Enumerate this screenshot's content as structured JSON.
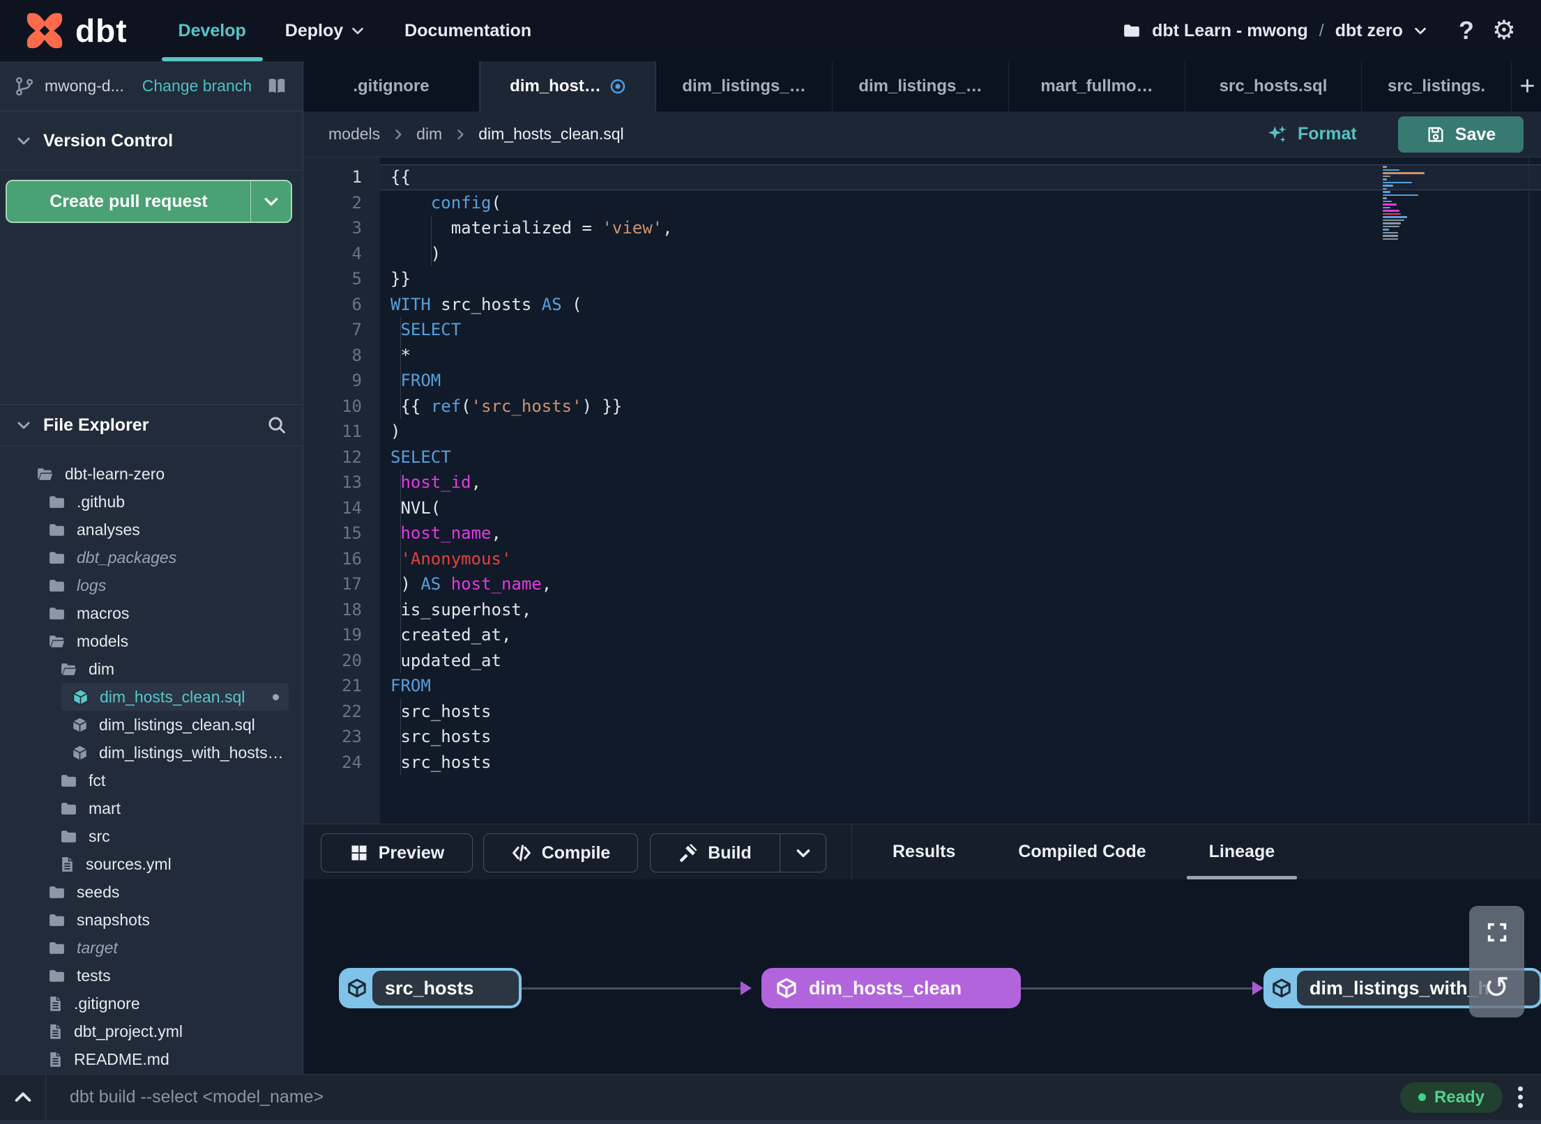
{
  "nav": {
    "brand": "dbt",
    "items": [
      {
        "label": "Develop",
        "active": true
      },
      {
        "label": "Deploy",
        "dropdown": true
      },
      {
        "label": "Documentation"
      }
    ],
    "project": {
      "name": "dbt Learn - mwong",
      "separator": "/",
      "env": "dbt zero"
    },
    "help": "?"
  },
  "icons": {
    "gear": "⚙",
    "refresh": "↺",
    "plus_label": "+"
  },
  "sidebar": {
    "branch": {
      "name": "mwong-d...",
      "action": "Change branch"
    },
    "version_control": {
      "title": "Version Control",
      "button": "Create pull request"
    },
    "file_explorer": {
      "title": "File Explorer",
      "tree": [
        {
          "label": "dbt-learn-zero",
          "depth": 0,
          "icon": "folder-open"
        },
        {
          "label": ".github",
          "depth": 1,
          "icon": "folder"
        },
        {
          "label": "analyses",
          "depth": 1,
          "icon": "folder"
        },
        {
          "label": "dbt_packages",
          "depth": 1,
          "icon": "folder",
          "italic": true
        },
        {
          "label": "logs",
          "depth": 1,
          "icon": "folder",
          "italic": true
        },
        {
          "label": "macros",
          "depth": 1,
          "icon": "folder"
        },
        {
          "label": "models",
          "depth": 1,
          "icon": "folder-open"
        },
        {
          "label": "dim",
          "depth": 2,
          "icon": "folder-open"
        },
        {
          "label": "dim_hosts_clean.sql",
          "depth": 3,
          "icon": "model",
          "selected": true,
          "modified": true
        },
        {
          "label": "dim_listings_clean.sql",
          "depth": 3,
          "icon": "model"
        },
        {
          "label": "dim_listings_with_hosts…",
          "depth": 3,
          "icon": "model"
        },
        {
          "label": "fct",
          "depth": 2,
          "icon": "folder"
        },
        {
          "label": "mart",
          "depth": 2,
          "icon": "folder"
        },
        {
          "label": "src",
          "depth": 2,
          "icon": "folder"
        },
        {
          "label": "sources.yml",
          "depth": 2,
          "icon": "file"
        },
        {
          "label": "seeds",
          "depth": 1,
          "icon": "folder"
        },
        {
          "label": "snapshots",
          "depth": 1,
          "icon": "folder"
        },
        {
          "label": "target",
          "depth": 1,
          "icon": "folder",
          "italic": true
        },
        {
          "label": "tests",
          "depth": 1,
          "icon": "folder"
        },
        {
          "label": ".gitignore",
          "depth": 1,
          "icon": "file"
        },
        {
          "label": "dbt_project.yml",
          "depth": 1,
          "icon": "file"
        },
        {
          "label": "README.md",
          "depth": 1,
          "icon": "file"
        }
      ]
    }
  },
  "tabs": {
    "items": [
      {
        "label": ".gitignore"
      },
      {
        "label": "dim_host…",
        "active": true,
        "modified": true
      },
      {
        "label": "dim_listings_…"
      },
      {
        "label": "dim_listings_…"
      },
      {
        "label": "mart_fullmo…"
      },
      {
        "label": "src_hosts.sql"
      },
      {
        "label": "src_listings.",
        "last": true
      }
    ],
    "add": "+"
  },
  "editor": {
    "breadcrumb": [
      "models",
      "dim",
      "dim_hosts_clean.sql"
    ],
    "format_label": "Format",
    "save_label": "Save",
    "lines": [
      {
        "current": true,
        "tokens": [
          [
            "w",
            "{{"
          ]
        ]
      },
      {
        "tokens": [
          [
            "w",
            "    "
          ],
          [
            "f",
            "config"
          ],
          [
            "w",
            "("
          ]
        ]
      },
      {
        "tokens": [
          [
            "w",
            "    "
          ],
          [
            "g",
            ""
          ],
          [
            "w",
            "  materialized = "
          ],
          [
            "s",
            "'view'"
          ],
          [
            "w",
            ","
          ]
        ]
      },
      {
        "tokens": [
          [
            "w",
            "    "
          ],
          [
            "g",
            ""
          ],
          [
            "w",
            ")"
          ]
        ]
      },
      {
        "tokens": [
          [
            "w",
            "}}"
          ]
        ]
      },
      {
        "tokens": [
          [
            "k",
            "WITH"
          ],
          [
            "w",
            " src_hosts "
          ],
          [
            "k",
            "AS"
          ],
          [
            "w",
            " ("
          ]
        ]
      },
      {
        "tokens": [
          [
            "w",
            " "
          ],
          [
            "g",
            ""
          ],
          [
            "k",
            "SELECT"
          ]
        ]
      },
      {
        "tokens": [
          [
            "w",
            " "
          ],
          [
            "g",
            ""
          ],
          [
            "w",
            "*"
          ]
        ]
      },
      {
        "tokens": [
          [
            "w",
            " "
          ],
          [
            "g",
            ""
          ],
          [
            "k",
            "FROM"
          ]
        ]
      },
      {
        "tokens": [
          [
            "w",
            " "
          ],
          [
            "g",
            ""
          ],
          [
            "w",
            "{{ "
          ],
          [
            "f",
            "ref"
          ],
          [
            "w",
            "("
          ],
          [
            "s",
            "'src_hosts'"
          ],
          [
            "w",
            ") }}"
          ]
        ]
      },
      {
        "tokens": [
          [
            "w",
            ")"
          ]
        ]
      },
      {
        "tokens": [
          [
            "k",
            "SELECT"
          ]
        ]
      },
      {
        "tokens": [
          [
            "w",
            " "
          ],
          [
            "g",
            ""
          ],
          [
            "m",
            "host_id"
          ],
          [
            "w",
            ","
          ]
        ]
      },
      {
        "tokens": [
          [
            "w",
            " "
          ],
          [
            "g",
            ""
          ],
          [
            "w",
            "NVL("
          ]
        ]
      },
      {
        "tokens": [
          [
            "w",
            " "
          ],
          [
            "g",
            ""
          ],
          [
            "m",
            "host_name"
          ],
          [
            "w",
            ","
          ]
        ]
      },
      {
        "tokens": [
          [
            "w",
            " "
          ],
          [
            "g",
            ""
          ],
          [
            "r",
            "'Anonymous'"
          ]
        ]
      },
      {
        "tokens": [
          [
            "w",
            " "
          ],
          [
            "g",
            ""
          ],
          [
            "w",
            ") "
          ],
          [
            "k",
            "AS"
          ],
          [
            "w",
            " "
          ],
          [
            "m",
            "host_name"
          ],
          [
            "w",
            ","
          ]
        ]
      },
      {
        "tokens": [
          [
            "w",
            " "
          ],
          [
            "g",
            ""
          ],
          [
            "w",
            "is_superhost,"
          ]
        ]
      },
      {
        "tokens": [
          [
            "w",
            " "
          ],
          [
            "g",
            ""
          ],
          [
            "w",
            "created_at,"
          ]
        ]
      },
      {
        "tokens": [
          [
            "w",
            " "
          ],
          [
            "g",
            ""
          ],
          [
            "w",
            "updated_at"
          ]
        ]
      },
      {
        "tokens": [
          [
            "k",
            "FROM"
          ]
        ]
      },
      {
        "tokens": [
          [
            "w",
            " "
          ],
          [
            "g",
            ""
          ],
          [
            "w",
            "src_hosts"
          ]
        ]
      },
      {
        "tokens": [
          [
            "w",
            " "
          ],
          [
            "g",
            ""
          ],
          [
            "w",
            "src_hosts"
          ]
        ]
      },
      {
        "tokens": [
          [
            "w",
            " "
          ],
          [
            "g",
            ""
          ],
          [
            "w",
            "src_hosts"
          ]
        ]
      }
    ]
  },
  "bottom_panel": {
    "preview": "Preview",
    "compile": "Compile",
    "build": "Build",
    "tabs": [
      {
        "label": "Results"
      },
      {
        "label": "Compiled Code"
      },
      {
        "label": "Lineage",
        "active": true
      }
    ]
  },
  "lineage": {
    "nodes": [
      {
        "label": "src_hosts",
        "type": "source"
      },
      {
        "label": "dim_hosts_clean",
        "type": "model"
      },
      {
        "label": "dim_listings_with_h",
        "type": "source"
      }
    ]
  },
  "status_bar": {
    "command": "dbt build --select <model_name>",
    "ready": "Ready"
  },
  "colors": {
    "accent_teal": "#58c4c6",
    "brand_orange": "#ff6a4b",
    "button_green": "#4aa173",
    "save_teal": "#377a72",
    "node_purple": "#b264dd",
    "node_blue": "#7fc4e8",
    "ready_green": "#3ed489",
    "keyword_blue": "#57a0dc",
    "identifier_magenta": "#e23ae2",
    "string_salmon": "#cd9372",
    "string_red": "#e8403a"
  }
}
